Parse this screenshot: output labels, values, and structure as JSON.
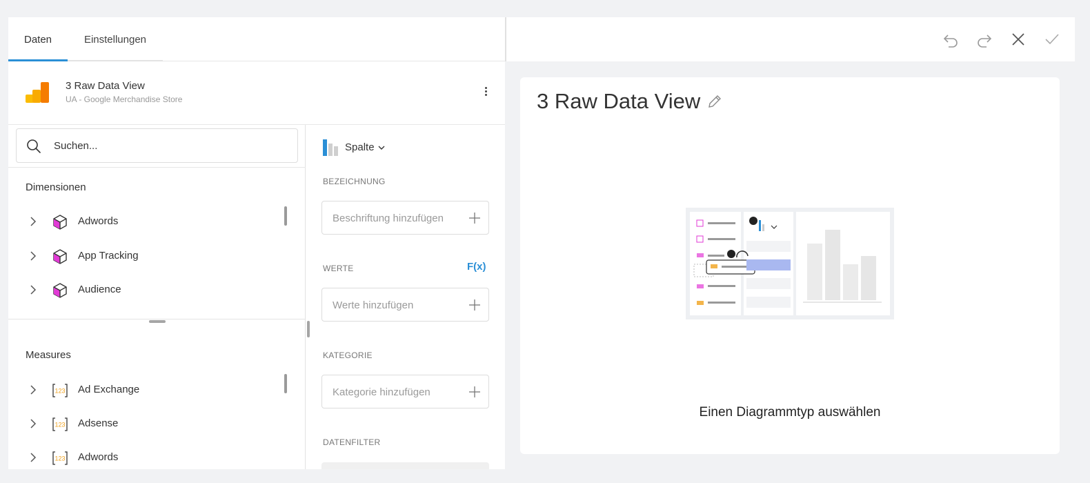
{
  "tabs": [
    {
      "label": "Daten",
      "active": true
    },
    {
      "label": "Einstellungen",
      "active": false
    }
  ],
  "source": {
    "title": "3 Raw Data View",
    "subtitle": "UA - Google Merchandise Store"
  },
  "search": {
    "placeholder": "Suchen..."
  },
  "dimensions": {
    "title": "Dimensionen",
    "items": [
      {
        "label": "Adwords",
        "icon": "cube-icon"
      },
      {
        "label": "App Tracking",
        "icon": "cube-icon"
      },
      {
        "label": "Audience",
        "icon": "cube-icon"
      }
    ]
  },
  "measures": {
    "title": "Measures",
    "items": [
      {
        "label": "Ad Exchange",
        "icon": "numeric-123-icon"
      },
      {
        "label": "Adsense",
        "icon": "numeric-123-icon"
      },
      {
        "label": "Adwords",
        "icon": "numeric-123-icon"
      }
    ]
  },
  "chart_type": {
    "label": "Spalte"
  },
  "properties": {
    "label_section": "BEZEICHNUNG",
    "label_placeholder": "Beschriftung hinzufügen",
    "values_section": "WERTE",
    "values_placeholder": "Werte hinzufügen",
    "fx": "F(x)",
    "category_section": "KATEGORIE",
    "category_placeholder": "Kategorie hinzufügen",
    "filter_section": "DATENFILTER"
  },
  "toolbar": {
    "undo": "undo-icon",
    "redo": "redo-icon",
    "close": "close-icon",
    "confirm": "check-icon"
  },
  "editor": {
    "title": "3 Raw Data View",
    "empty_message": "Einen Diagrammtyp auswählen"
  },
  "colors": {
    "accent": "#2b8fd6",
    "dimension_icon": "#e23ad6",
    "measure_icon": "#f0a21e",
    "logo_orange": "#f57c00",
    "logo_yellow": "#fbbc04"
  }
}
